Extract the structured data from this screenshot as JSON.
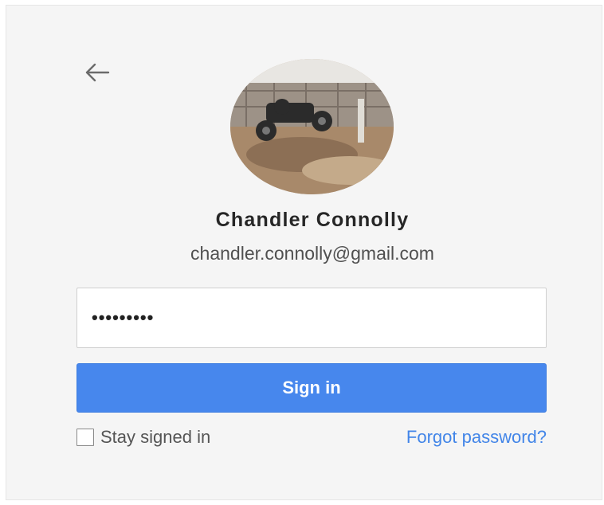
{
  "account": {
    "name": "Chandler Connolly",
    "email": "chandler.connolly@gmail.com"
  },
  "password": {
    "value": "•••••••••"
  },
  "buttons": {
    "sign_in": "Sign in"
  },
  "options": {
    "stay_signed_in": "Stay signed in",
    "stay_signed_in_checked": false,
    "forgot_password": "Forgot password?"
  },
  "icons": {
    "back": "back-arrow-icon",
    "avatar": "profile-photo"
  },
  "colors": {
    "primary": "#4787ed",
    "link": "#4285e8",
    "background": "#f5f5f5"
  }
}
